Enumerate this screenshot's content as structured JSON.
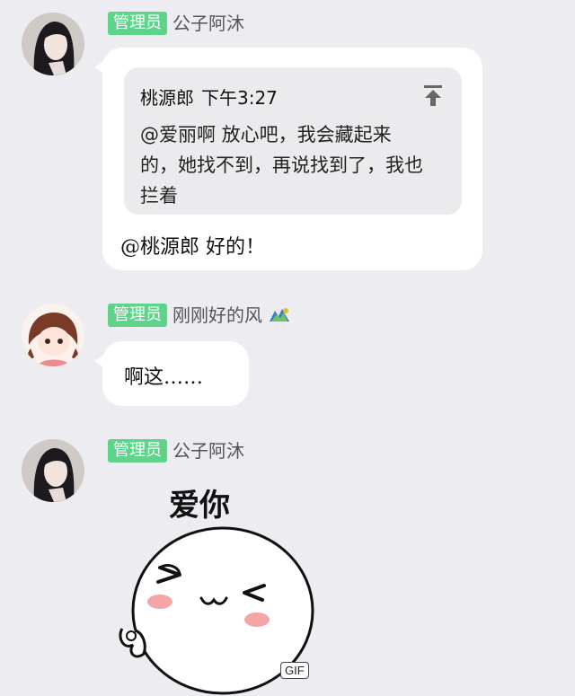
{
  "messages": [
    {
      "sender": {
        "role": "管理员",
        "nickname": "公子阿沐"
      },
      "quote": {
        "author": "桃源郎",
        "time": "下午3:27",
        "text": "@爱丽啊 放心吧，我会藏起来的，她找不到，再说找到了，我也拦着"
      },
      "text": "@桃源郎 好的！"
    },
    {
      "sender": {
        "role": "管理员",
        "nickname": "刚刚好的风"
      },
      "text": "啊这……"
    },
    {
      "sender": {
        "role": "管理员",
        "nickname": "公子阿沐"
      },
      "sticker": {
        "caption": "爱你",
        "tag": "GIF"
      }
    }
  ]
}
